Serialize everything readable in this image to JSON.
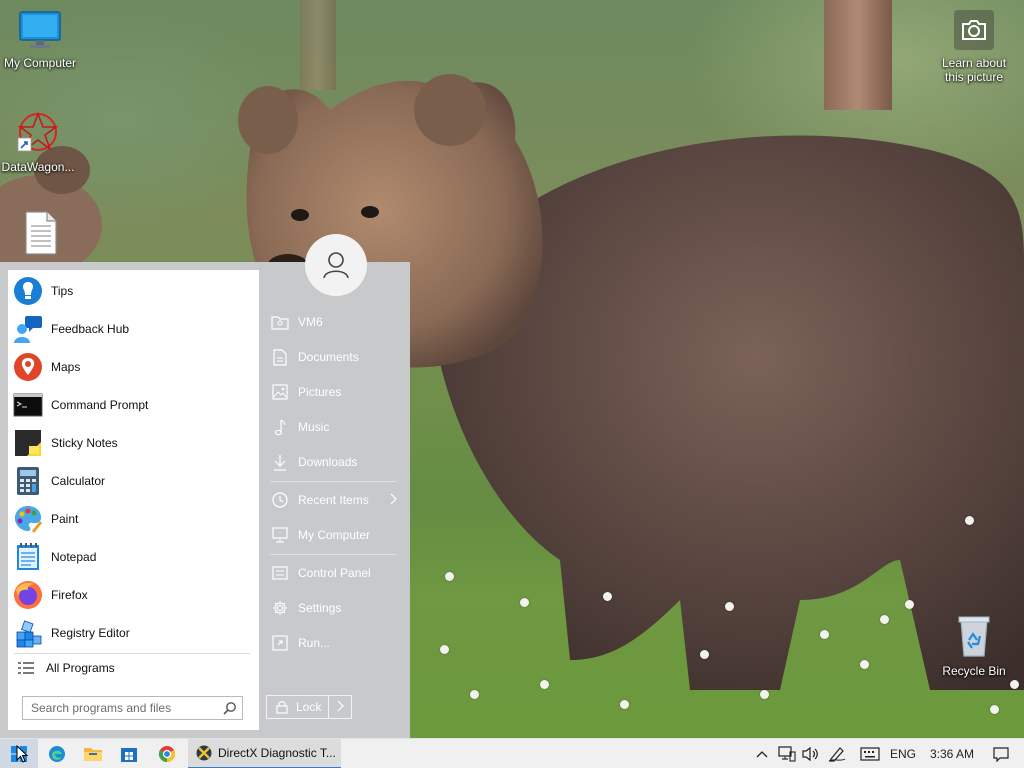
{
  "desktop": {
    "icons": [
      {
        "name": "my-computer",
        "label": "My Computer"
      },
      {
        "name": "datawagon",
        "label": "DataWagon..."
      },
      {
        "name": "text-file",
        "label": ""
      },
      {
        "name": "learn-about-picture",
        "label": "Learn about\nthis picture"
      },
      {
        "name": "recycle-bin",
        "label": "Recycle Bin"
      }
    ]
  },
  "start_menu": {
    "programs": [
      {
        "label": "Tips",
        "icon": "tips-icon"
      },
      {
        "label": "Feedback Hub",
        "icon": "feedback-hub-icon"
      },
      {
        "label": "Maps",
        "icon": "maps-icon"
      },
      {
        "label": "Command Prompt",
        "icon": "command-prompt-icon"
      },
      {
        "label": "Sticky Notes",
        "icon": "sticky-notes-icon"
      },
      {
        "label": "Calculator",
        "icon": "calculator-icon"
      },
      {
        "label": "Paint",
        "icon": "paint-icon"
      },
      {
        "label": "Notepad",
        "icon": "notepad-icon"
      },
      {
        "label": "Firefox",
        "icon": "firefox-icon"
      },
      {
        "label": "Registry Editor",
        "icon": "registry-editor-icon"
      }
    ],
    "all_programs": "All Programs",
    "search_placeholder": "Search programs and files",
    "places": [
      {
        "label": "VM6",
        "icon": "user-folder-icon"
      },
      {
        "label": "Documents",
        "icon": "documents-icon"
      },
      {
        "label": "Pictures",
        "icon": "pictures-icon"
      },
      {
        "label": "Music",
        "icon": "music-icon"
      },
      {
        "label": "Downloads",
        "icon": "downloads-icon"
      },
      {
        "label": "Recent Items",
        "icon": "recent-items-icon"
      },
      {
        "label": "My Computer",
        "icon": "computer-icon"
      },
      {
        "label": "Control Panel",
        "icon": "control-panel-icon"
      },
      {
        "label": "Settings",
        "icon": "settings-gear-icon"
      },
      {
        "label": "Run...",
        "icon": "run-icon"
      }
    ],
    "lock_label": "Lock"
  },
  "taskbar": {
    "running_task": "DirectX Diagnostic T...",
    "language": "ENG",
    "clock": "3:36 AM",
    "accent_color": "#3c7cc4"
  }
}
